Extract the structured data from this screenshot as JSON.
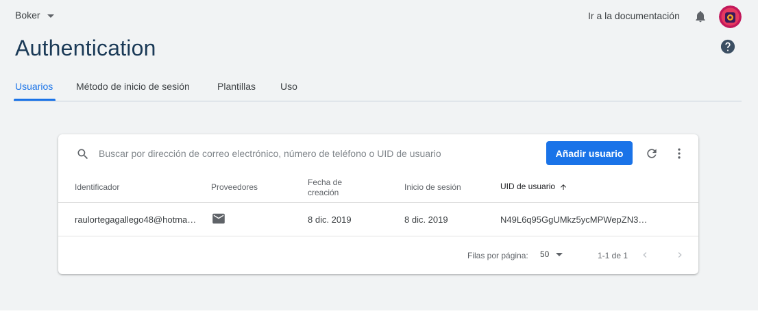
{
  "header": {
    "project_name": "Boker",
    "docs_link": "Ir a la documentación",
    "title": "Authentication"
  },
  "icons": {
    "project_dropdown": "chevron-down-icon",
    "notifications": "bell-icon",
    "avatar": "avatar",
    "help": "help-icon",
    "search": "search-icon",
    "refresh": "refresh-icon",
    "more": "more-vert-icon",
    "provider": "email-icon",
    "sort": "arrow-up-icon",
    "prev": "chevron-left-icon",
    "next": "chevron-right-icon"
  },
  "tabs": [
    {
      "label": "Usuarios",
      "active": true
    },
    {
      "label": "Método de inicio de sesión",
      "active": false
    },
    {
      "label": "Plantillas",
      "active": false
    },
    {
      "label": "Uso",
      "active": false
    }
  ],
  "toolbar": {
    "search_placeholder": "Buscar por dirección de correo electrónico, número de teléfono o UID de usuario",
    "add_user_label": "Añadir usuario"
  },
  "table": {
    "columns": [
      "Identificador",
      "Proveedores",
      "Fecha de creación",
      "Inicio de sesión",
      "UID de usuario"
    ],
    "created_line1": "Fecha de",
    "created_line2": "creación",
    "rows": [
      {
        "identifier": "raulortegagallego48@hotma…",
        "provider": "email",
        "created": "8 dic. 2019",
        "signed_in": "8 dic. 2019",
        "uid": "N49L6q95GgUMkz5ycMPWepZN3…"
      }
    ]
  },
  "pagination": {
    "rows_per_page_label": "Filas por página:",
    "rows_per_page_value": "50",
    "range": "1-1 de 1"
  },
  "colors": {
    "accent": "#1a73e8",
    "title": "#1b3a57",
    "background": "#f1f3f4"
  }
}
